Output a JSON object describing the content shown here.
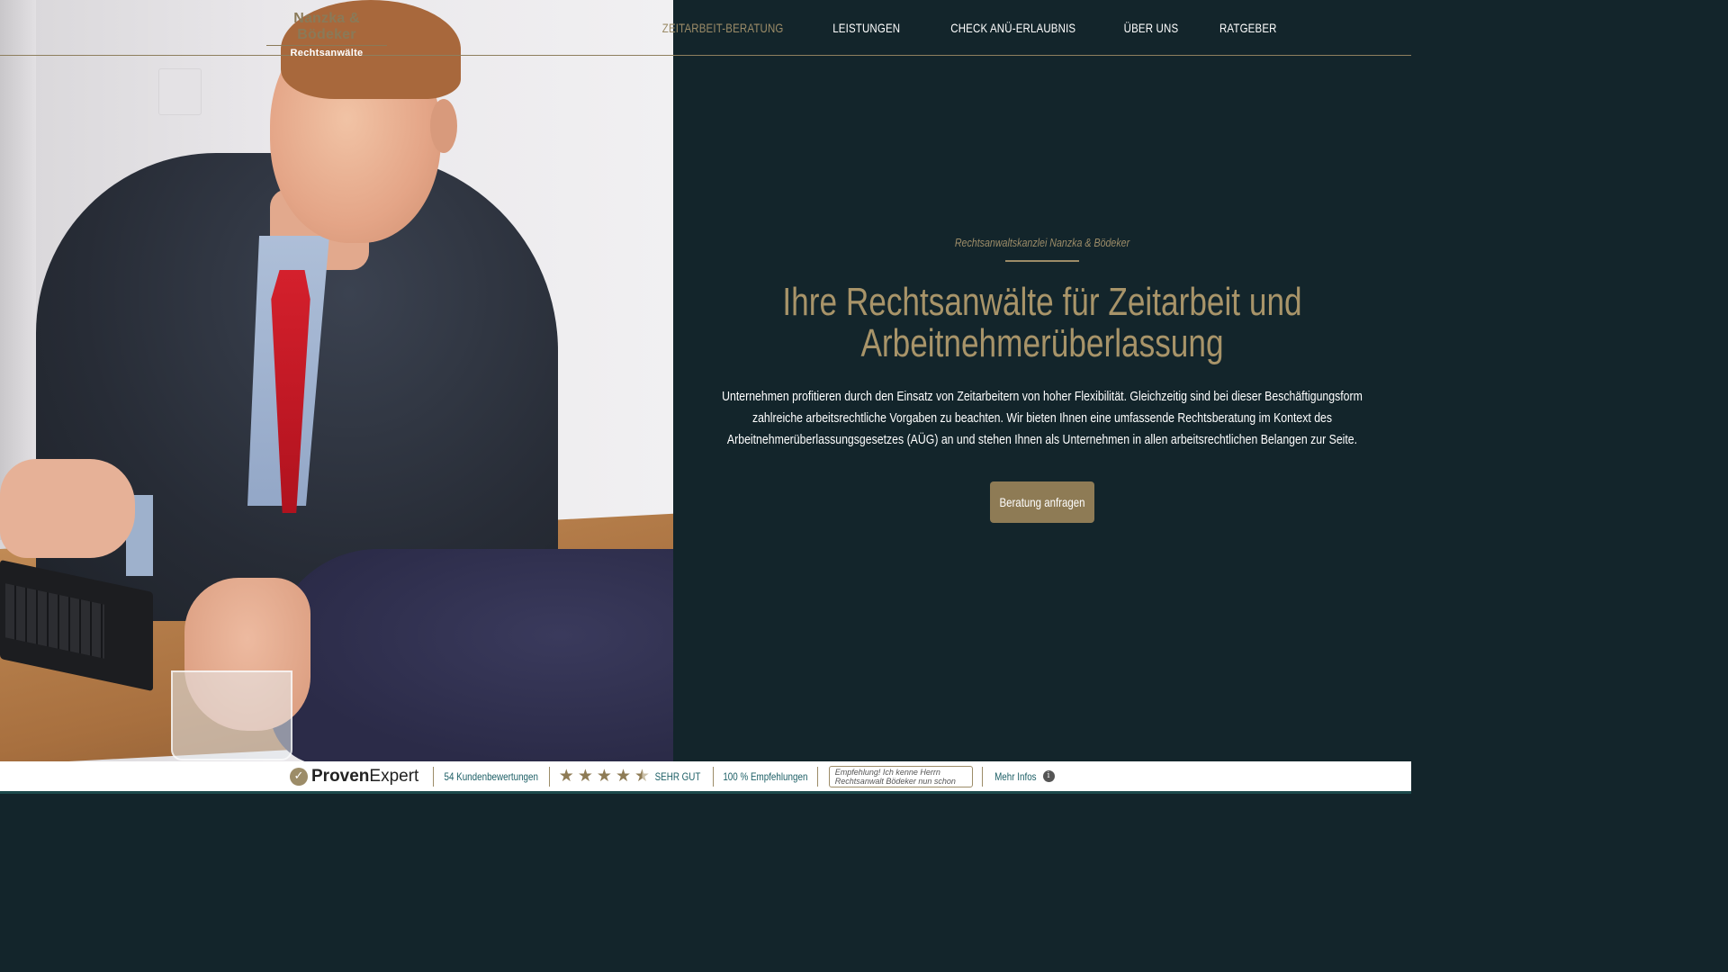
{
  "header": {
    "logo": {
      "name": "Nanzka & Bödeker",
      "subtitle": "Rechtsanwälte"
    },
    "nav": [
      {
        "label": "ZEITARBEIT-BERATUNG",
        "active": true
      },
      {
        "label": "LEISTUNGEN",
        "active": false
      },
      {
        "label": "CHECK ANÜ-ERLAUBNIS",
        "active": false
      },
      {
        "label": "ÜBER UNS",
        "active": false
      },
      {
        "label": "RATGEBER",
        "active": false
      }
    ]
  },
  "hero": {
    "eyebrow": "Rechtsanwaltskanzlei Nanzka & Bödeker",
    "headline_line1": "Ihre Rechtsanwälte für Zeitarbeit und",
    "headline_line2": "Arbeitnehmerüberlassung",
    "lead": "Unternehmen profitieren durch den Einsatz von Zeitarbeitern von hoher Flexibilität. Gleichzeitig sind bei dieser Beschäftigungsform zahlreiche arbeitsrechtliche Vorgaben zu beachten. Wir bieten Ihnen eine umfassende Rechtsberatung im Kontext des Arbeitnehmerüberlassungsgesetzes (AÜG) an und stehen Ihnen als Unternehmen in allen arbeitsrechtlichen Belangen zur Seite.",
    "cta_label": "Beratung anfragen"
  },
  "proven_expert": {
    "brand_bold": "Proven",
    "brand_regular": "Expert",
    "reviews": "54 Kundenbewertungen",
    "rating_stars": 4.5,
    "rating_label": "SEHR GUT",
    "recommendations": "100 % Empfehlungen",
    "quote": "Empfehlung! Ich kenne Herrn Rechtsanwalt Bödeker nun schon seit kna...",
    "more_info": "Mehr Infos"
  },
  "colors": {
    "background": "#13252b",
    "accent_gold": "#9c8c68",
    "button": "#8e7b55",
    "bar_border": "#1d4a4c"
  }
}
